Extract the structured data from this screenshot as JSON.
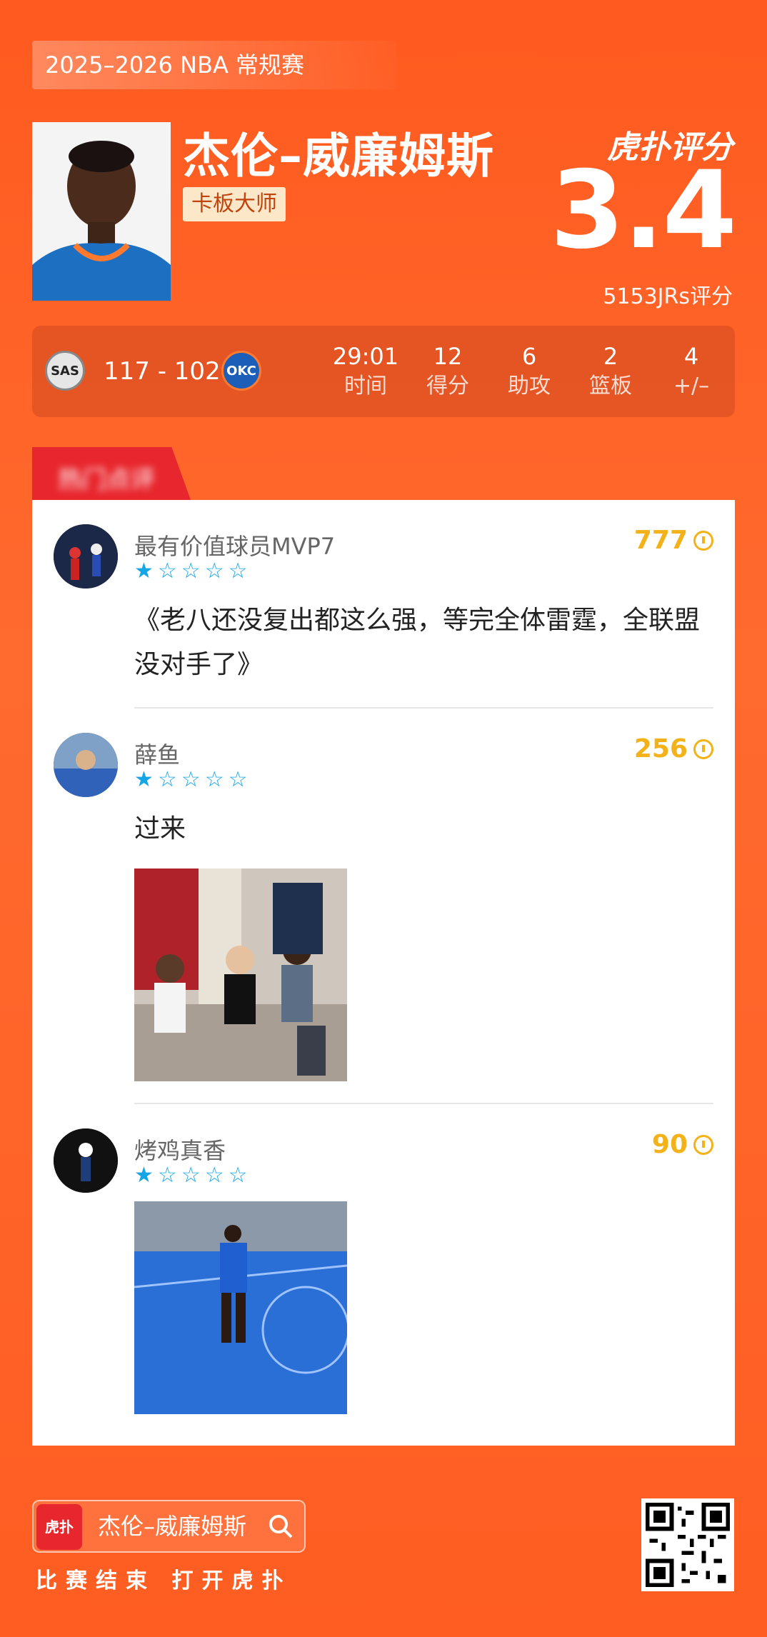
{
  "header": {
    "season": "2025–2026 NBA 常规赛",
    "player_name": "杰伦–威廉姆斯",
    "tag": "卡板大师",
    "brand": "虎扑评分",
    "score": "3.4",
    "rating_count": "5153JRs评分"
  },
  "game": {
    "home_abbr": "SAS",
    "away_abbr": "OKC",
    "score": "117 - 102",
    "stats": [
      {
        "value": "29:01",
        "label": "时间"
      },
      {
        "value": "12",
        "label": "得分"
      },
      {
        "value": "6",
        "label": "助攻"
      },
      {
        "value": "2",
        "label": "篮板"
      },
      {
        "value": "4",
        "label": "+/–"
      }
    ]
  },
  "section_tab": "热门点评",
  "comments": [
    {
      "user": "最有价值球员MVP7",
      "stars": 1,
      "likes": "777",
      "text": "《老八还没复出都这么强，等完全体雷霆，全联盟没对手了》"
    },
    {
      "user": "薛鱼",
      "stars": 1,
      "likes": "256",
      "text": "过来"
    },
    {
      "user": "烤鸡真香",
      "stars": 1,
      "likes": "90",
      "text": ""
    }
  ],
  "footer": {
    "logo_text": "虎扑",
    "search_name": "杰伦–威廉姆斯",
    "bottom_text": "比赛结束 打开虎扑"
  },
  "colors": {
    "accent": "#ff5a1f",
    "red": "#e8262d",
    "star": "#15a6e8",
    "likes": "#f3b21a"
  }
}
